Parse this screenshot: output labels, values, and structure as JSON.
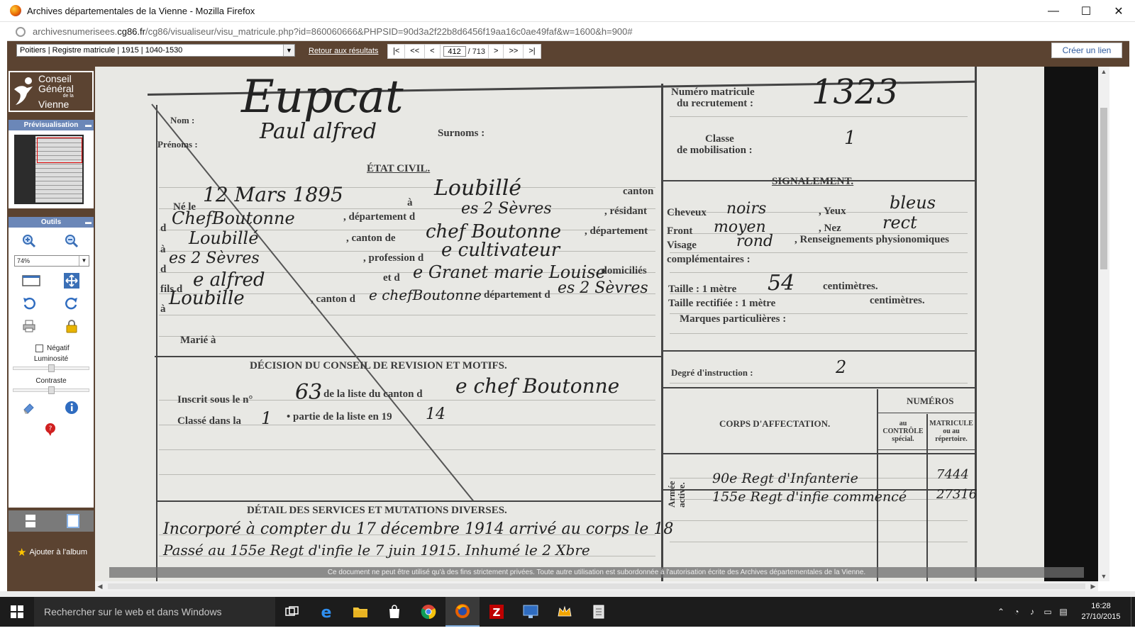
{
  "window": {
    "title": "Archives départementales de la Vienne - Mozilla Firefox",
    "minimize": "—",
    "maximize": "☐",
    "close": "✕"
  },
  "address": {
    "url_prefix": "archivesnumerisees.",
    "url_domain": "cg86.fr",
    "url_rest": "/cg86/visualiseur/visu_matricule.php?id=860060666&PHPSID=90d3a2f22b8d6456f19aa16c0ae49faf&w=1600&h=900#"
  },
  "toolbar": {
    "register_select": "Poitiers | Registre matricule | 1915 | 1040-1530",
    "back_to_results": "Retour aux résultats",
    "nav": {
      "first": "|<",
      "prev_fast": "<<",
      "prev": "<",
      "page_current": "412",
      "page_total": "/ 713",
      "next": ">",
      "next_fast": ">>",
      "last": ">|"
    },
    "create_link": "Créer un lien"
  },
  "sidebar": {
    "logo_line1": "Conseil",
    "logo_line2": "Général",
    "logo_line3": "de la",
    "logo_line4": "Vienne",
    "preview_title": "Prévisualisation",
    "tools_title": "Outils",
    "zoom_value": "74%",
    "negatif_label": "Négatif",
    "luminosite_label": "Luminosité",
    "luminosite_value": 0.5,
    "contraste_label": "Contraste",
    "contraste_value": 0.5,
    "album_label": "Ajouter à l'album"
  },
  "document": {
    "printed": {
      "nom": "Nom :",
      "prenoms": "Prénoms :",
      "surnoms": "Surnoms :",
      "etat_civil": "ÉTAT CIVIL.",
      "ne_le": "Né le",
      "a1": "à",
      "canton1": "canton",
      "de1": "d",
      "departement_d": ", département d",
      "residant": ", résidant",
      "a2": "à",
      "canton_de": ", canton de",
      "departement2": ", département",
      "d2": "d",
      "profession": ", profession d",
      "fils_de": "fils d",
      "et_de": "et d",
      "domicilies": ", domiciliés",
      "a3": "à",
      "canton_d": ", canton d",
      "departement_des": "département d",
      "marie_a": "Marié  à",
      "decision_title": "DÉCISION DU CONSEIL DE REVISION ET MOTIFS.",
      "inscrit": "Inscrit sous le n°",
      "de_la_liste": "de la liste du canton d",
      "classe_dans": "Classé dans la",
      "partie": "• partie de la liste en 19",
      "detail_title": "DÉTAIL DES SERVICES ET MUTATIONS DIVERSES.",
      "numero_matricule": "Numéro matricule",
      "du_recrutement": "du recrutement :",
      "classe": "Classe",
      "de_mobilisation": "de mobilisation :",
      "signalement": "SIGNALEMENT.",
      "cheveux": "Cheveux",
      "yeux": ", Yeux",
      "front": "Front",
      "nez": ", Nez",
      "visage": "Visage",
      "renseignements": ", Renseignements physionomiques",
      "complementaires": "complémentaires :",
      "taille": "Taille : 1 mètre",
      "centimetres1": "centimètres.",
      "taille_rectifiee": "Taille rectifiée : 1 mètre",
      "centimetres2": "centimètres.",
      "marques": "Marques particulières :",
      "degre": "Degré d'instruction :",
      "numeros": "NUMÉROS",
      "corps": "CORPS D'AFFECTATION.",
      "au_controle": "au\nCONTRÔLE\nspécial.",
      "matricule_repertoire": "MATRICULE\nou au\nrépertoire.",
      "armee_active": "Armée\nactive."
    },
    "handwritten": {
      "nom": "Eupcat",
      "prenoms": "Paul alfred",
      "matricule": "1323",
      "classe": "1",
      "date_naissance": "12 Mars 1895",
      "lieu_naissance": "Loubillé",
      "canton_naissance": "ChefBoutonne",
      "dept_naissance": "es 2 Sèvres",
      "residence": "Loubillé",
      "canton_residence": "chef Boutonne",
      "dept_residence": "es 2 Sèvres",
      "profession": "e cultivateur",
      "pere": "e alfred",
      "mere": "e Granet marie Louise",
      "domicile": "Loubille",
      "canton_domicile": "e chefBoutonne",
      "dept_domicile": "es 2 Sèvres",
      "cheveux": "noirs",
      "yeux": "bleus",
      "front": "moyen",
      "nez": "rect",
      "visage": "rond",
      "taille": "54",
      "degre": "2",
      "inscrit_num": "63",
      "canton_liste": "e chef Boutonne",
      "classe_partie": "1",
      "annee": "14",
      "affectation": "90e Regt d'Infanterie\n155e Regt d'infie commencé",
      "matricule_corps": "7444\n27316",
      "services_line1": "Incorporé à compter du 17 décembre 1914 arrivé au corps le 18",
      "services_line2": "Passé au 155e Regt d'infie le 7 juin 1915.   Inhumé le 2 Xbre"
    },
    "copyright": "Ce document ne peut être utilisé qu'à des fins strictement privées. Toute autre utilisation est subordonnée à l'autorisation écrite des Archives départementales de la Vienne."
  },
  "taskbar": {
    "search_placeholder": "Rechercher sur le web et dans Windows",
    "time": "16:28",
    "date": "27/10/2015"
  }
}
